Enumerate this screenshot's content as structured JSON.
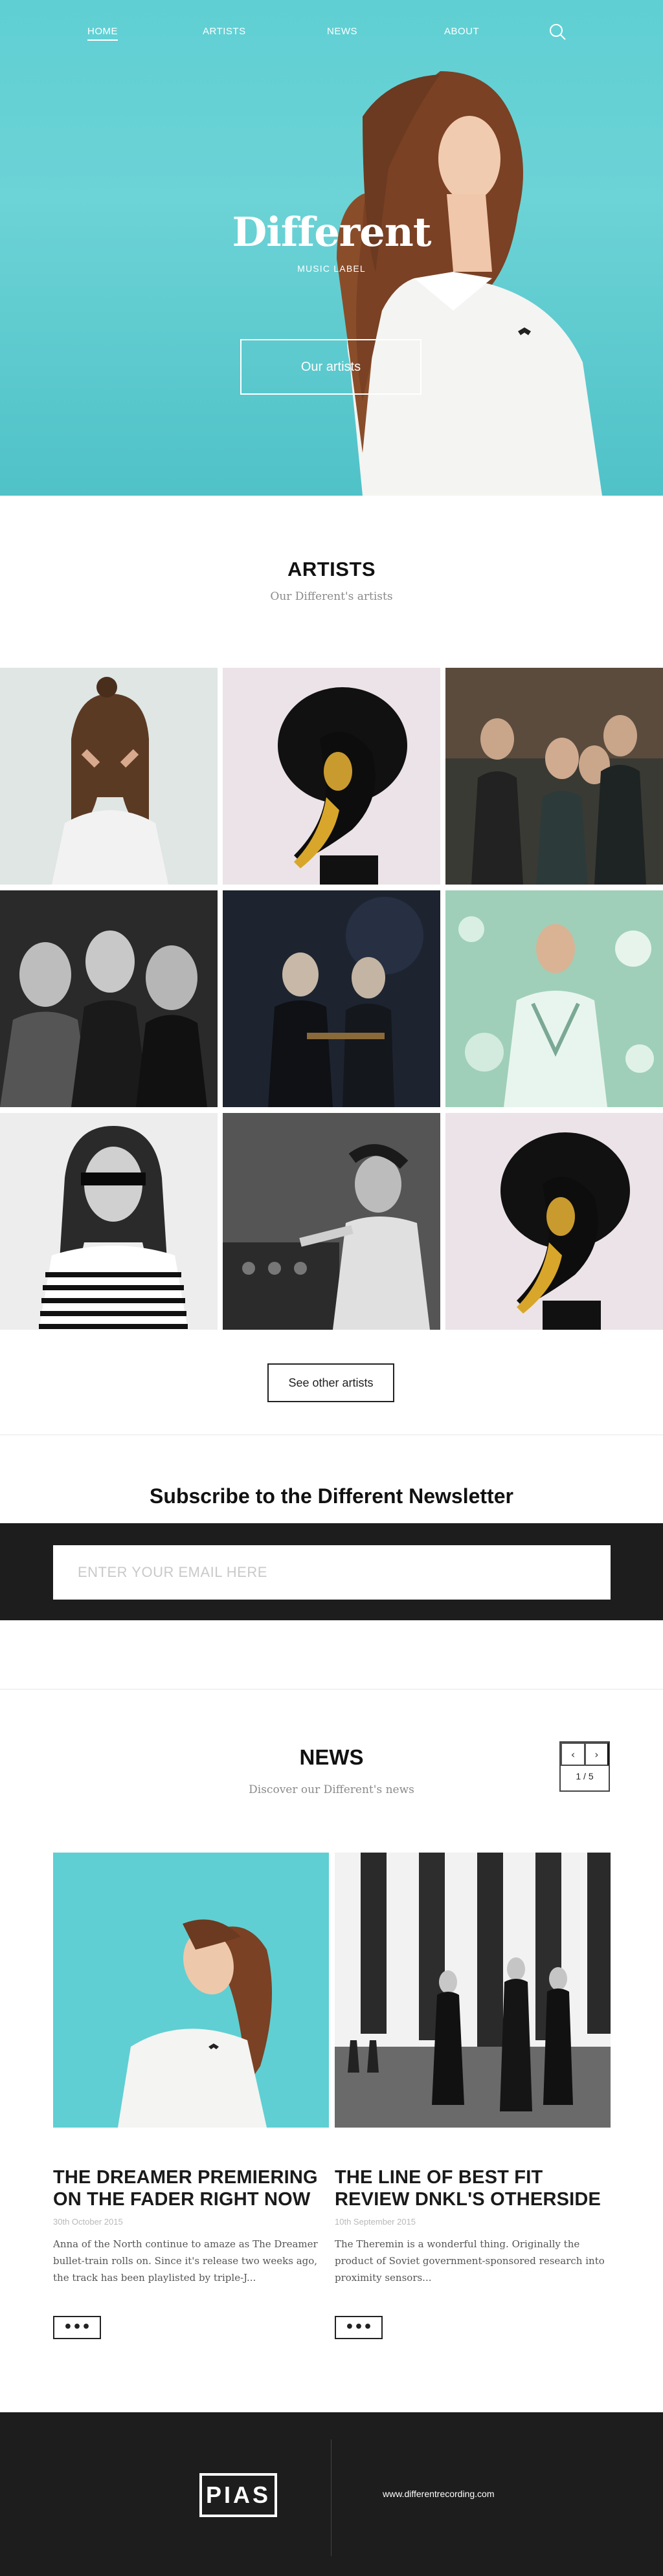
{
  "nav": {
    "items": [
      {
        "label": "HOME",
        "active": true
      },
      {
        "label": "ARTISTS",
        "active": false
      },
      {
        "label": "NEWS",
        "active": false
      },
      {
        "label": "ABOUT",
        "active": false
      }
    ],
    "search_icon": "search-icon"
  },
  "hero": {
    "title": "Different",
    "subtitle": "MUSIC LABEL",
    "button_label": "Our artists",
    "background_color": "#5fcfd3"
  },
  "artists": {
    "title": "ARTISTS",
    "subtitle": "Our Different's artists",
    "see_other_label": "See other artists"
  },
  "newsletter": {
    "title": "Subscribe to the Different Newsletter",
    "email_placeholder": "ENTER YOUR EMAIL HERE"
  },
  "news": {
    "title": "NEWS",
    "subtitle": "Discover our Different's news",
    "pager": {
      "prev": "‹",
      "next": "›",
      "count": "1 / 5"
    },
    "articles": [
      {
        "title": "THE DREAMER PREMIERING ON THE FADER RIGHT NOW",
        "date": "30th October 2015",
        "excerpt": "Anna of the North continue to amaze as The Dreamer bullet-train rolls on. Since it's release two weeks ago, the track has been playlisted by triple-J...",
        "more_label": "•••"
      },
      {
        "title": "THE LINE OF BEST FIT REVIEW DNKL'S OTHERSIDE",
        "date": "10th September 2015",
        "excerpt": "The Theremin is a wonderful thing. Originally the product of Soviet government-sponsored research into proximity sensors...",
        "more_label": "•••"
      }
    ]
  },
  "footer": {
    "logo": "PIAS",
    "link": "www.differentrecording.com"
  },
  "colors": {
    "accent_teal": "#5fcfd3",
    "dark": "#1d1d1d"
  }
}
